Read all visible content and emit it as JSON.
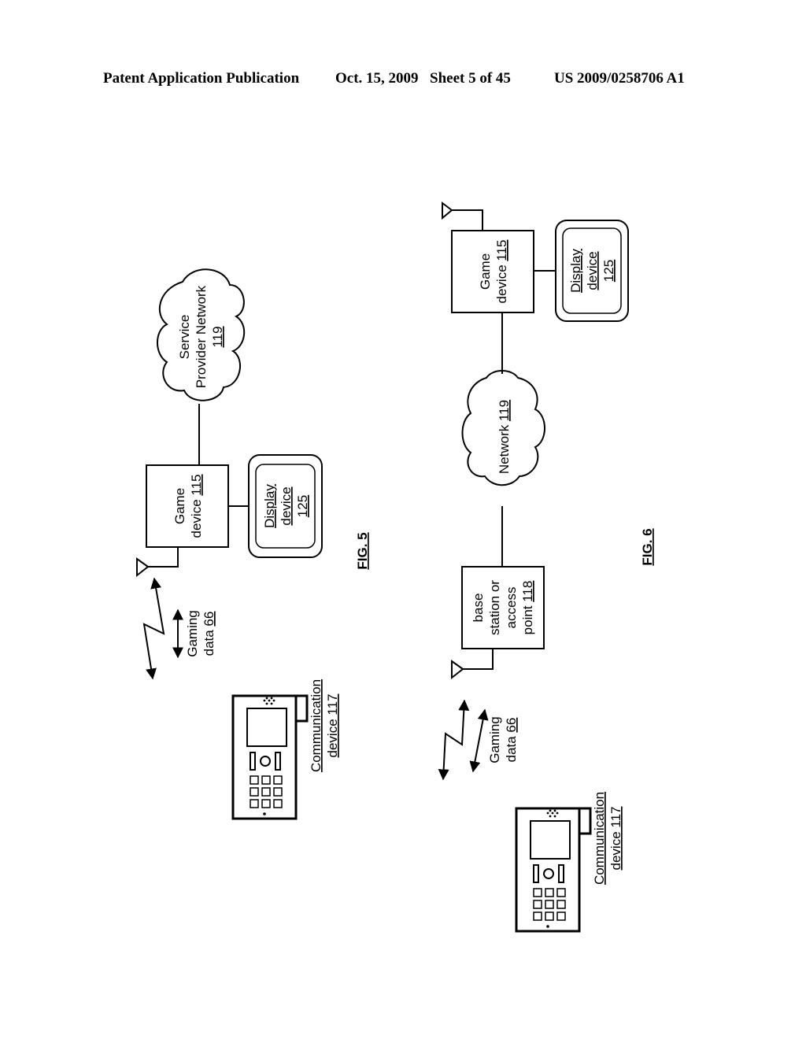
{
  "header": {
    "publication": "Patent Application Publication",
    "date": "Oct. 15, 2009",
    "sheet": "Sheet 5 of 45",
    "patent_number": "US 2009/0258706 A1"
  },
  "fig5": {
    "label": "FIG. 5",
    "network": {
      "line1": "Service",
      "line2": "Provider Network",
      "ref": "119"
    },
    "game_device": {
      "line1": "Game",
      "line2": "device ",
      "ref": "115"
    },
    "display_device": {
      "line1": "Display",
      "line2": "device",
      "ref": "125"
    },
    "gaming_data": {
      "line1": "Gaming",
      "line2": "data ",
      "ref": "66"
    },
    "communication_device": {
      "line1": "Communication",
      "line2": "device 117"
    }
  },
  "fig6": {
    "label": "FIG. 6",
    "network": {
      "text": "Network ",
      "ref": "119"
    },
    "game_device": {
      "line1": "Game",
      "line2": "device ",
      "ref": "115"
    },
    "display_device": {
      "line1": "Display",
      "line2": "device",
      "ref": "125"
    },
    "base_station": {
      "line1": "base",
      "line2": "station or",
      "line3": "access",
      "line4": "point ",
      "ref": "118"
    },
    "gaming_data": {
      "line1": "Gaming",
      "line2": "data ",
      "ref": "66"
    },
    "communication_device": {
      "line1": "Communication",
      "line2": "device 117"
    }
  }
}
